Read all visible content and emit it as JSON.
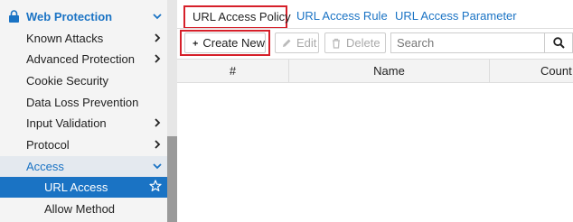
{
  "sidebar": {
    "items": [
      {
        "label": "Web Protection"
      },
      {
        "label": "Known Attacks"
      },
      {
        "label": "Advanced Protection"
      },
      {
        "label": "Cookie Security"
      },
      {
        "label": "Data Loss Prevention"
      },
      {
        "label": "Input Validation"
      },
      {
        "label": "Protocol"
      },
      {
        "label": "Access"
      },
      {
        "label": "URL Access"
      },
      {
        "label": "Allow Method"
      }
    ]
  },
  "tabs": [
    {
      "label": "URL Access Policy"
    },
    {
      "label": "URL Access Rule"
    },
    {
      "label": "URL Access Parameter"
    }
  ],
  "toolbar": {
    "create_label": "Create New",
    "edit_label": "Edit",
    "delete_label": "Delete"
  },
  "search": {
    "placeholder": "Search"
  },
  "table": {
    "columns": [
      "#",
      "Name",
      "Count"
    ]
  },
  "colors": {
    "accent": "#1a73c4",
    "highlight_box": "#d6202a"
  }
}
